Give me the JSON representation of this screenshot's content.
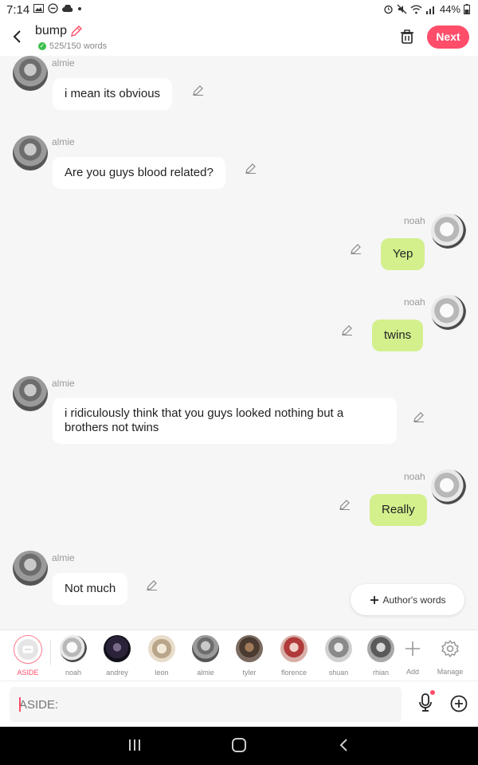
{
  "status": {
    "time": "7:14",
    "battery": "44%"
  },
  "header": {
    "title": "bump",
    "word_count": "525/150 words",
    "next_label": "Next"
  },
  "messages": [
    {
      "sender": "almie",
      "text": "i mean its obvious",
      "side": "left"
    },
    {
      "sender": "almie",
      "text": "Are you guys blood related?",
      "side": "left"
    },
    {
      "sender": "noah",
      "text": "Yep",
      "side": "right"
    },
    {
      "sender": "noah",
      "text": "twins",
      "side": "right"
    },
    {
      "sender": "almie",
      "text": "i ridiculously think that you guys looked nothing but a brothers not twins",
      "side": "left"
    },
    {
      "sender": "noah",
      "text": "Really",
      "side": "right"
    },
    {
      "sender": "almie",
      "text": "Not much",
      "side": "left"
    }
  ],
  "authors_words": "Author's words",
  "characters": {
    "aside": "ASIDE",
    "list": [
      "noah",
      "andrey",
      "leon",
      "almie",
      "tyler",
      "florence",
      "shuan",
      "rhian"
    ],
    "add": "Add",
    "manage": "Manage"
  },
  "input": {
    "placeholder": "ASIDE:"
  },
  "colors": {
    "accent": "#ff4d6a",
    "right_bubble": "#d3f08d"
  }
}
